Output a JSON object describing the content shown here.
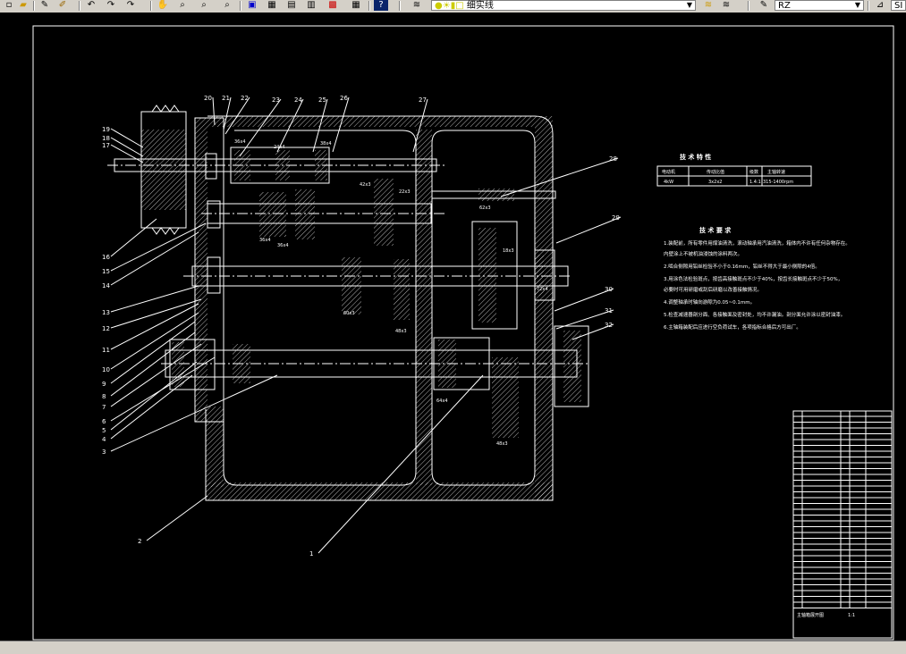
{
  "toolbar": {
    "layer_name": "细实线",
    "linetype_value": "RZ",
    "right_value": "SI"
  },
  "drawing": {
    "part_labels": [
      "1",
      "2",
      "3",
      "4",
      "5",
      "6",
      "7",
      "8",
      "9",
      "10",
      "11",
      "12",
      "13",
      "14",
      "15",
      "16",
      "17",
      "18",
      "19",
      "20",
      "21",
      "22",
      "23",
      "24",
      "25",
      "26",
      "27",
      "28",
      "29",
      "30",
      "31",
      "32"
    ],
    "dims": {
      "d1": "36x4",
      "d2": "36x4",
      "d3": "24x4",
      "d4": "38x4",
      "d5": "42x3",
      "d6": "22x3",
      "d7": "36x4",
      "d8": "60x3",
      "d9": "48x3",
      "d10": "62x3",
      "d11": "18x3",
      "d12": "64x4",
      "d13": "48x3",
      "d14": "72x4"
    },
    "tech_spec": {
      "title": "技 术 特 性",
      "headers": [
        "电动机",
        "传动比值",
        "级数",
        "主轴转速"
      ],
      "row": [
        "4kW",
        "3x2x2",
        "1.4:1",
        "315-1400rpm"
      ]
    },
    "tech_req": {
      "title": "技 术 要 求",
      "lines": [
        "1.装配前，所有零件用煤油清洗，滚动轴承用汽油清洗，箱体内不许有任何杂物存在。",
        "  内壁涂上不被机油浸蚀的涂料两次。",
        "2.啮合侧隙用铅丝检验不小于0.16mm，铅丝不得大于最小侧隙的4倍。",
        "3.用涂色法检验斑点，按齿高接触斑点不少于40%，按齿长接触斑点不少于50%，",
        "  必要时可用研磨或刮后研磨以改善接触情况。",
        "4.调整轴承时轴向游隙为0.05~0.1mm。",
        "5.检查减速器剖分面、各接触面及密封处，均不许漏油。剖分面允许涂以密封油漆。",
        "6.主轴箱装配后应进行空负荷试车，各项指标合格后方可出厂。"
      ]
    },
    "title_block": {
      "name": "主轴箱展开图",
      "scale": "1:1"
    }
  }
}
